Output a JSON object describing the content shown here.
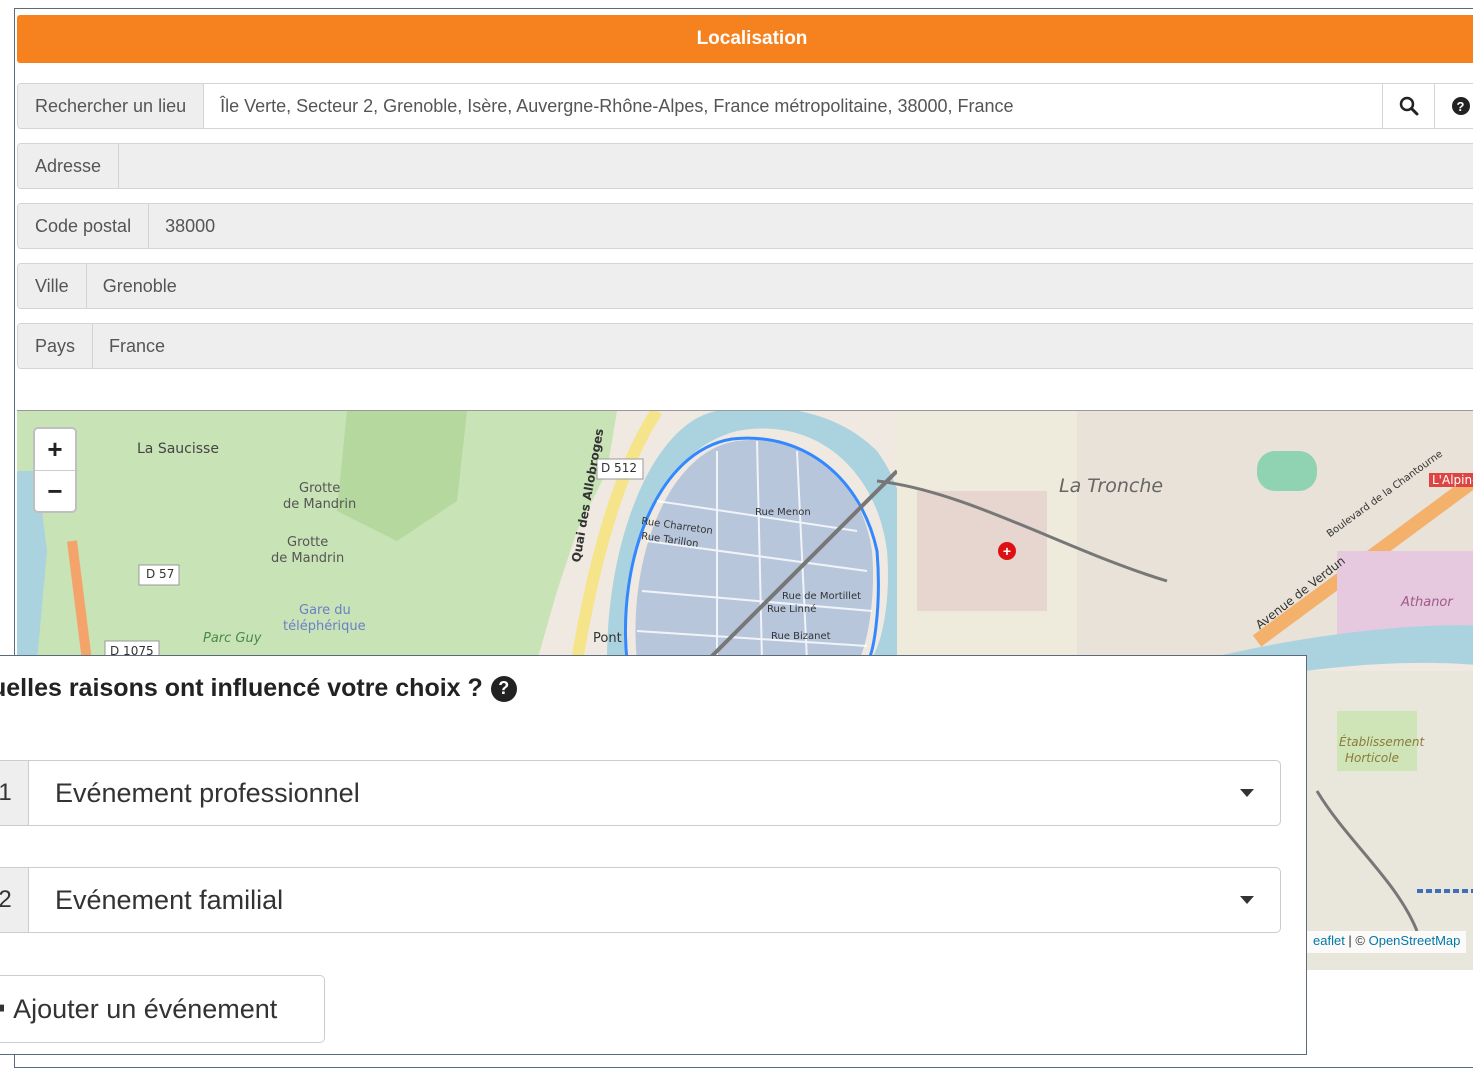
{
  "panel": {
    "header_title": "Localisation",
    "search": {
      "label": "Rechercher un lieu",
      "value": "Île Verte, Secteur 2, Grenoble, Isère, Auvergne-Rhône-Alpes, France métropolitaine, 38000, France",
      "search_icon": "search-icon",
      "help_icon": "question-circle-icon"
    },
    "adresse": {
      "label": "Adresse",
      "value": ""
    },
    "code_postal": {
      "label": "Code postal",
      "value": "38000"
    },
    "ville": {
      "label": "Ville",
      "value": "Grenoble"
    },
    "pays": {
      "label": "Pays",
      "value": "France"
    }
  },
  "map": {
    "zoom_in": "+",
    "zoom_out": "−",
    "labels": {
      "la_saucisse": "La Saucisse",
      "grotte1a": "Grotte",
      "grotte1b": "de Mandrin",
      "grotte2a": "Grotte",
      "grotte2b": "de Mandrin",
      "gare_a": "Gare du",
      "gare_b": "téléphérique",
      "parc_guy": "Parc Guy",
      "d57": "D 57",
      "d1075": "D 1075",
      "d512": "D 512",
      "quai_allobroges": "Quai des Allobroges",
      "rue_charreton": "Rue Charreton",
      "rue_tarillon": "Rue Tarillon",
      "rue_menon": "Rue Menon",
      "rue_mortillet": "Rue de Mortillet",
      "rue_linne": "Rue Linné",
      "rue_bizanet": "Rue Bizanet",
      "pont": "Pont",
      "la_tronche": "La Tronche",
      "avenue_verdun": "Avenue de Verdun",
      "athanor": "Athanor",
      "l_alpine": "L'Alpine",
      "etab_a": "Établissement",
      "etab_b": "Horticole",
      "bd_chantourne": "Boulevard de la Chantourne"
    },
    "attribution_prefix": "eaflet",
    "attribution_sep": " | © ",
    "attribution_link": "OpenStreetMap"
  },
  "dialog": {
    "question": "uelles raisons ont influencé votre choix ?",
    "help_icon": "question-circle-icon",
    "selects": [
      {
        "number": "1",
        "value": "Evénement professionnel"
      },
      {
        "number": "2",
        "value": "Evénement familial"
      }
    ],
    "add_button": "Ajouter un événement",
    "colors": {
      "accent": "#f5821f",
      "map_route": "#3388ff"
    }
  }
}
